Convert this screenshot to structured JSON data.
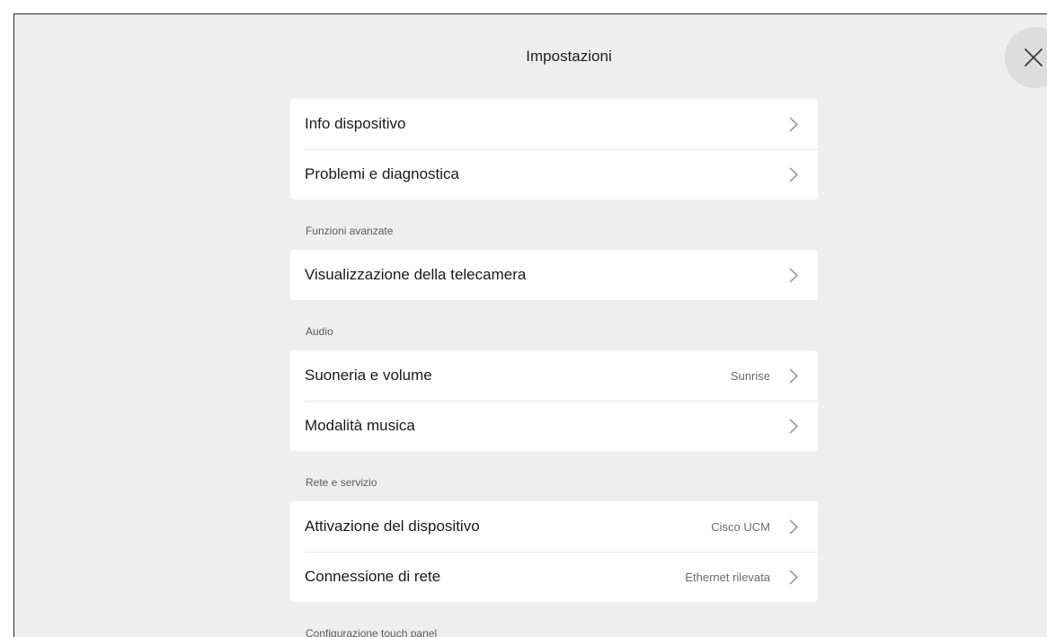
{
  "header": {
    "title": "Impostazioni",
    "close_icon": "close-icon"
  },
  "groups": [
    {
      "section": "",
      "items": [
        {
          "label": "Info dispositivo",
          "value": ""
        },
        {
          "label": "Problemi e diagnostica",
          "value": ""
        }
      ]
    },
    {
      "section": "Funzioni avanzate",
      "items": [
        {
          "label": "Visualizzazione della telecamera",
          "value": ""
        }
      ]
    },
    {
      "section": "Audio",
      "items": [
        {
          "label": "Suoneria e volume",
          "value": "Sunrise"
        },
        {
          "label": "Modalità musica",
          "value": ""
        }
      ]
    },
    {
      "section": "Rete e servizio",
      "items": [
        {
          "label": "Attivazione del dispositivo",
          "value": "Cisco UCM"
        },
        {
          "label": "Connessione di rete",
          "value": "Ethernet rilevata"
        }
      ]
    },
    {
      "section": "Configurazione touch panel",
      "items": []
    }
  ],
  "colors": {
    "background": "#eeeeee",
    "card": "#ffffff",
    "text": "#1a1a1a",
    "secondary_text": "#6b6b6b",
    "chevron": "#9a9a9a"
  }
}
